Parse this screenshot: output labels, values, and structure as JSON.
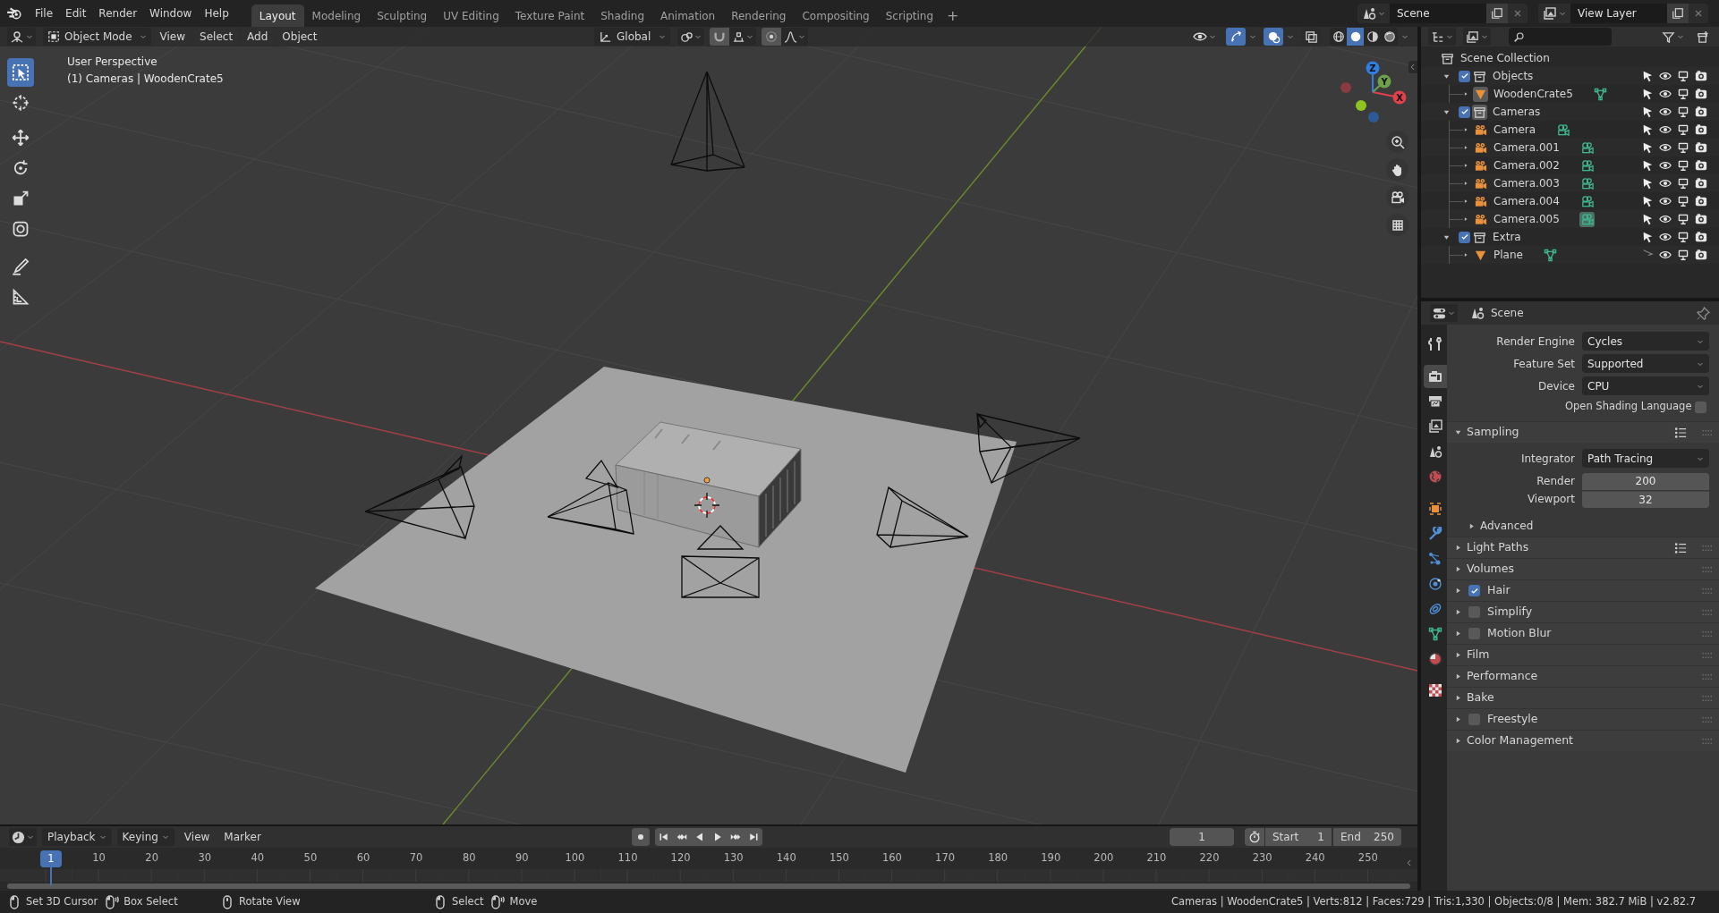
{
  "top_bar": {
    "menus": [
      "File",
      "Edit",
      "Render",
      "Window",
      "Help"
    ],
    "workspaces": [
      {
        "label": "Layout",
        "selected": true
      },
      {
        "label": "Modeling",
        "selected": false
      },
      {
        "label": "Sculpting",
        "selected": false
      },
      {
        "label": "UV Editing",
        "selected": false
      },
      {
        "label": "Texture Paint",
        "selected": false
      },
      {
        "label": "Shading",
        "selected": false
      },
      {
        "label": "Animation",
        "selected": false
      },
      {
        "label": "Rendering",
        "selected": false
      },
      {
        "label": "Compositing",
        "selected": false
      },
      {
        "label": "Scripting",
        "selected": false
      }
    ],
    "add_workspace": "+",
    "scene": "Scene",
    "view_layer": "View Layer"
  },
  "viewport": {
    "header": {
      "mode": "Object Mode",
      "menus": [
        "View",
        "Select",
        "Add",
        "Object"
      ],
      "orientation": "Global",
      "toggles": [
        {
          "kind": "gizmos",
          "on": true
        },
        {
          "kind": "overlays",
          "on": true
        },
        {
          "kind": "xray",
          "on": false
        }
      ],
      "shading_modes": [
        {
          "kind": "wireframe",
          "selected": false
        },
        {
          "kind": "solid",
          "selected": true
        },
        {
          "kind": "material",
          "selected": false
        },
        {
          "kind": "rendered",
          "selected": false
        }
      ]
    },
    "overlay_text": [
      "User Perspective",
      "(1) Cameras | WoodenCrate5"
    ],
    "tools": [
      {
        "kind": "select",
        "selected": true
      },
      {
        "kind": "cursor",
        "selected": false
      },
      {
        "kind": "move",
        "selected": false
      },
      {
        "kind": "rotate",
        "selected": false
      },
      {
        "kind": "scale",
        "selected": false
      },
      {
        "kind": "transform",
        "selected": false
      },
      {
        "kind": "annotate",
        "selected": false
      },
      {
        "kind": "measure",
        "selected": false
      }
    ],
    "gizmo": {
      "axes": [
        "X",
        "Y",
        "Z"
      ]
    }
  },
  "outliner": {
    "tree": [
      {
        "label": "Scene Collection",
        "kind": "scene_collection",
        "children": [
          {
            "label": "Objects",
            "kind": "collection",
            "checked": true,
            "expanded": true,
            "active": false,
            "selectable": true,
            "children": [
              {
                "label": "WoodenCrate5",
                "kind": "mesh",
                "expanded": false,
                "active": true,
                "data_active": false,
                "selectable": true
              }
            ]
          },
          {
            "label": "Cameras",
            "kind": "collection",
            "checked": true,
            "expanded": true,
            "active": true,
            "selectable": true,
            "children": [
              {
                "label": "Camera",
                "kind": "camera",
                "expanded": false,
                "active": false,
                "data_active": false,
                "selectable": true
              },
              {
                "label": "Camera.001",
                "kind": "camera",
                "expanded": false,
                "active": false,
                "data_active": false,
                "selectable": true
              },
              {
                "label": "Camera.002",
                "kind": "camera",
                "expanded": false,
                "active": false,
                "data_active": false,
                "selectable": true
              },
              {
                "label": "Camera.003",
                "kind": "camera",
                "expanded": false,
                "active": false,
                "data_active": false,
                "selectable": true
              },
              {
                "label": "Camera.004",
                "kind": "camera",
                "expanded": false,
                "active": false,
                "data_active": false,
                "selectable": true
              },
              {
                "label": "Camera.005",
                "kind": "camera",
                "expanded": false,
                "active": false,
                "data_active": true,
                "selectable": true
              }
            ]
          },
          {
            "label": "Extra",
            "kind": "collection",
            "checked": true,
            "expanded": true,
            "active": false,
            "selectable": true,
            "children": [
              {
                "label": "Plane",
                "kind": "mesh",
                "expanded": false,
                "active": false,
                "data_active": false,
                "selectable": false
              }
            ]
          }
        ]
      }
    ]
  },
  "properties": {
    "context": "Scene",
    "tabs": [
      {
        "kind": "tool",
        "selected": false
      },
      {
        "kind": "render",
        "selected": true
      },
      {
        "kind": "output",
        "selected": false
      },
      {
        "kind": "view_layer",
        "selected": false
      },
      {
        "kind": "scene",
        "selected": false
      },
      {
        "kind": "world",
        "selected": false
      },
      {
        "kind": "object",
        "selected": false
      },
      {
        "kind": "modifiers",
        "selected": false
      },
      {
        "kind": "particles",
        "selected": false
      },
      {
        "kind": "physics",
        "selected": false
      },
      {
        "kind": "constraints",
        "selected": false
      },
      {
        "kind": "data",
        "selected": false
      },
      {
        "kind": "material",
        "selected": false
      },
      {
        "kind": "texture",
        "selected": false
      }
    ],
    "fields": [
      {
        "label": "Render Engine",
        "kind": "dropdown",
        "value": "Cycles"
      },
      {
        "label": "Feature Set",
        "kind": "dropdown",
        "value": "Supported"
      },
      {
        "label": "Device",
        "kind": "dropdown",
        "value": "CPU"
      },
      {
        "label": "Open Shading Language",
        "kind": "checkbox",
        "checked": false
      }
    ],
    "panels": [
      {
        "label": "Sampling",
        "kind": "plain",
        "expanded": true,
        "presets": true,
        "fields": [
          {
            "label": "Integrator",
            "kind": "dropdown",
            "value": "Path Tracing"
          },
          {
            "label": "Render",
            "kind": "number",
            "value": "200"
          },
          {
            "label": "Viewport",
            "kind": "number",
            "value": "32"
          }
        ],
        "subpanels": [
          {
            "label": "Advanced",
            "expanded": false
          }
        ]
      },
      {
        "label": "Light Paths",
        "kind": "plain",
        "expanded": false,
        "presets": true
      },
      {
        "label": "Volumes",
        "kind": "plain",
        "expanded": false,
        "presets": false
      },
      {
        "label": "Hair",
        "kind": "toggle",
        "checked": true,
        "expanded": false,
        "presets": false
      },
      {
        "label": "Simplify",
        "kind": "toggle",
        "checked": false,
        "expanded": false,
        "presets": false
      },
      {
        "label": "Motion Blur",
        "kind": "toggle",
        "checked": false,
        "expanded": false,
        "presets": false
      },
      {
        "label": "Film",
        "kind": "plain",
        "expanded": false,
        "presets": false
      },
      {
        "label": "Performance",
        "kind": "plain",
        "expanded": false,
        "presets": false
      },
      {
        "label": "Bake",
        "kind": "plain",
        "expanded": false,
        "presets": false
      },
      {
        "label": "Freestyle",
        "kind": "toggle",
        "checked": false,
        "expanded": false,
        "presets": false
      },
      {
        "label": "Color Management",
        "kind": "plain",
        "expanded": false,
        "presets": false
      }
    ]
  },
  "timeline": {
    "menus": [
      "Playback",
      "Keying",
      "View",
      "Marker"
    ],
    "current_frame": "1",
    "frame_marker": "1",
    "ruler": [
      "10",
      "20",
      "30",
      "40",
      "50",
      "60",
      "70",
      "80",
      "90",
      "100",
      "110",
      "120",
      "130",
      "140",
      "150",
      "160",
      "170",
      "180",
      "190",
      "200",
      "210",
      "220",
      "230",
      "240",
      "250"
    ],
    "start_label": "Start",
    "start": "1",
    "end_label": "End",
    "end": "250"
  },
  "status_bar": {
    "hint_groups": [
      [
        {
          "kind": "click",
          "label": "Set 3D Cursor"
        },
        {
          "kind": "drag",
          "label": "Box Select"
        }
      ],
      [
        {
          "kind": "middle",
          "label": "Rotate View"
        }
      ],
      [
        {
          "kind": "click",
          "label": "Select"
        },
        {
          "kind": "drag",
          "label": "Move"
        }
      ]
    ],
    "stats": "Cameras | WoodenCrate5 | Verts:812 | Faces:729 | Tris:1,330 | Objects:0/8 | Mem: 382.7 MiB | v2.82.7"
  }
}
